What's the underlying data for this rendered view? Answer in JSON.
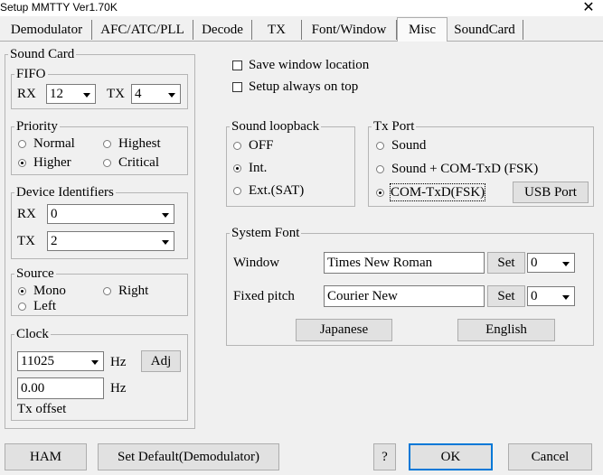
{
  "window": {
    "title": "Setup MMTTY Ver1.70K"
  },
  "tabs": [
    "Demodulator",
    "AFC/ATC/PLL",
    "Decode",
    "TX",
    "Font/Window",
    "Misc",
    "SoundCard"
  ],
  "sound_card": {
    "title": "Sound Card",
    "fifo": {
      "title": "FIFO",
      "rx_label": "RX",
      "rx_value": "12",
      "tx_label": "TX",
      "tx_value": "4"
    },
    "priority": {
      "title": "Priority",
      "options": [
        "Normal",
        "Highest",
        "Higher",
        "Critical"
      ],
      "selected": "Higher"
    },
    "device_identifiers": {
      "title": "Device Identifiers",
      "rx_label": "RX",
      "rx_value": "0",
      "tx_label": "TX",
      "tx_value": "2"
    },
    "source": {
      "title": "Source",
      "options": [
        "Mono",
        "Right",
        "Left"
      ],
      "selected": "Mono"
    },
    "clock": {
      "title": "Clock",
      "value": "11025",
      "unit": "Hz",
      "adj_label": "Adj",
      "offset_value": "0.00",
      "offset_unit": "Hz",
      "offset_label": "Tx offset"
    }
  },
  "options": {
    "save_window_location": "Save window location",
    "setup_always_on_top": "Setup always on top"
  },
  "sound_loopback": {
    "title": "Sound loopback",
    "options": [
      "OFF",
      "Int.",
      "Ext.(SAT)"
    ],
    "selected": "Int."
  },
  "tx_port": {
    "title": "Tx Port",
    "options": [
      "Sound",
      "Sound + COM-TxD (FSK)",
      "COM-TxD(FSK)"
    ],
    "selected": "COM-TxD(FSK)",
    "usb_port_label": "USB Port"
  },
  "system_font": {
    "title": "System Font",
    "window_label": "Window",
    "window_font": "Times New Roman",
    "window_set": "Set",
    "window_charset": "0",
    "fixed_label": "Fixed pitch",
    "fixed_font": "Courier New",
    "fixed_set": "Set",
    "fixed_charset": "0",
    "japanese_label": "Japanese",
    "english_label": "English"
  },
  "footer": {
    "ham": "HAM",
    "set_default": "Set Default(Demodulator)",
    "help": "?",
    "ok": "OK",
    "cancel": "Cancel"
  }
}
